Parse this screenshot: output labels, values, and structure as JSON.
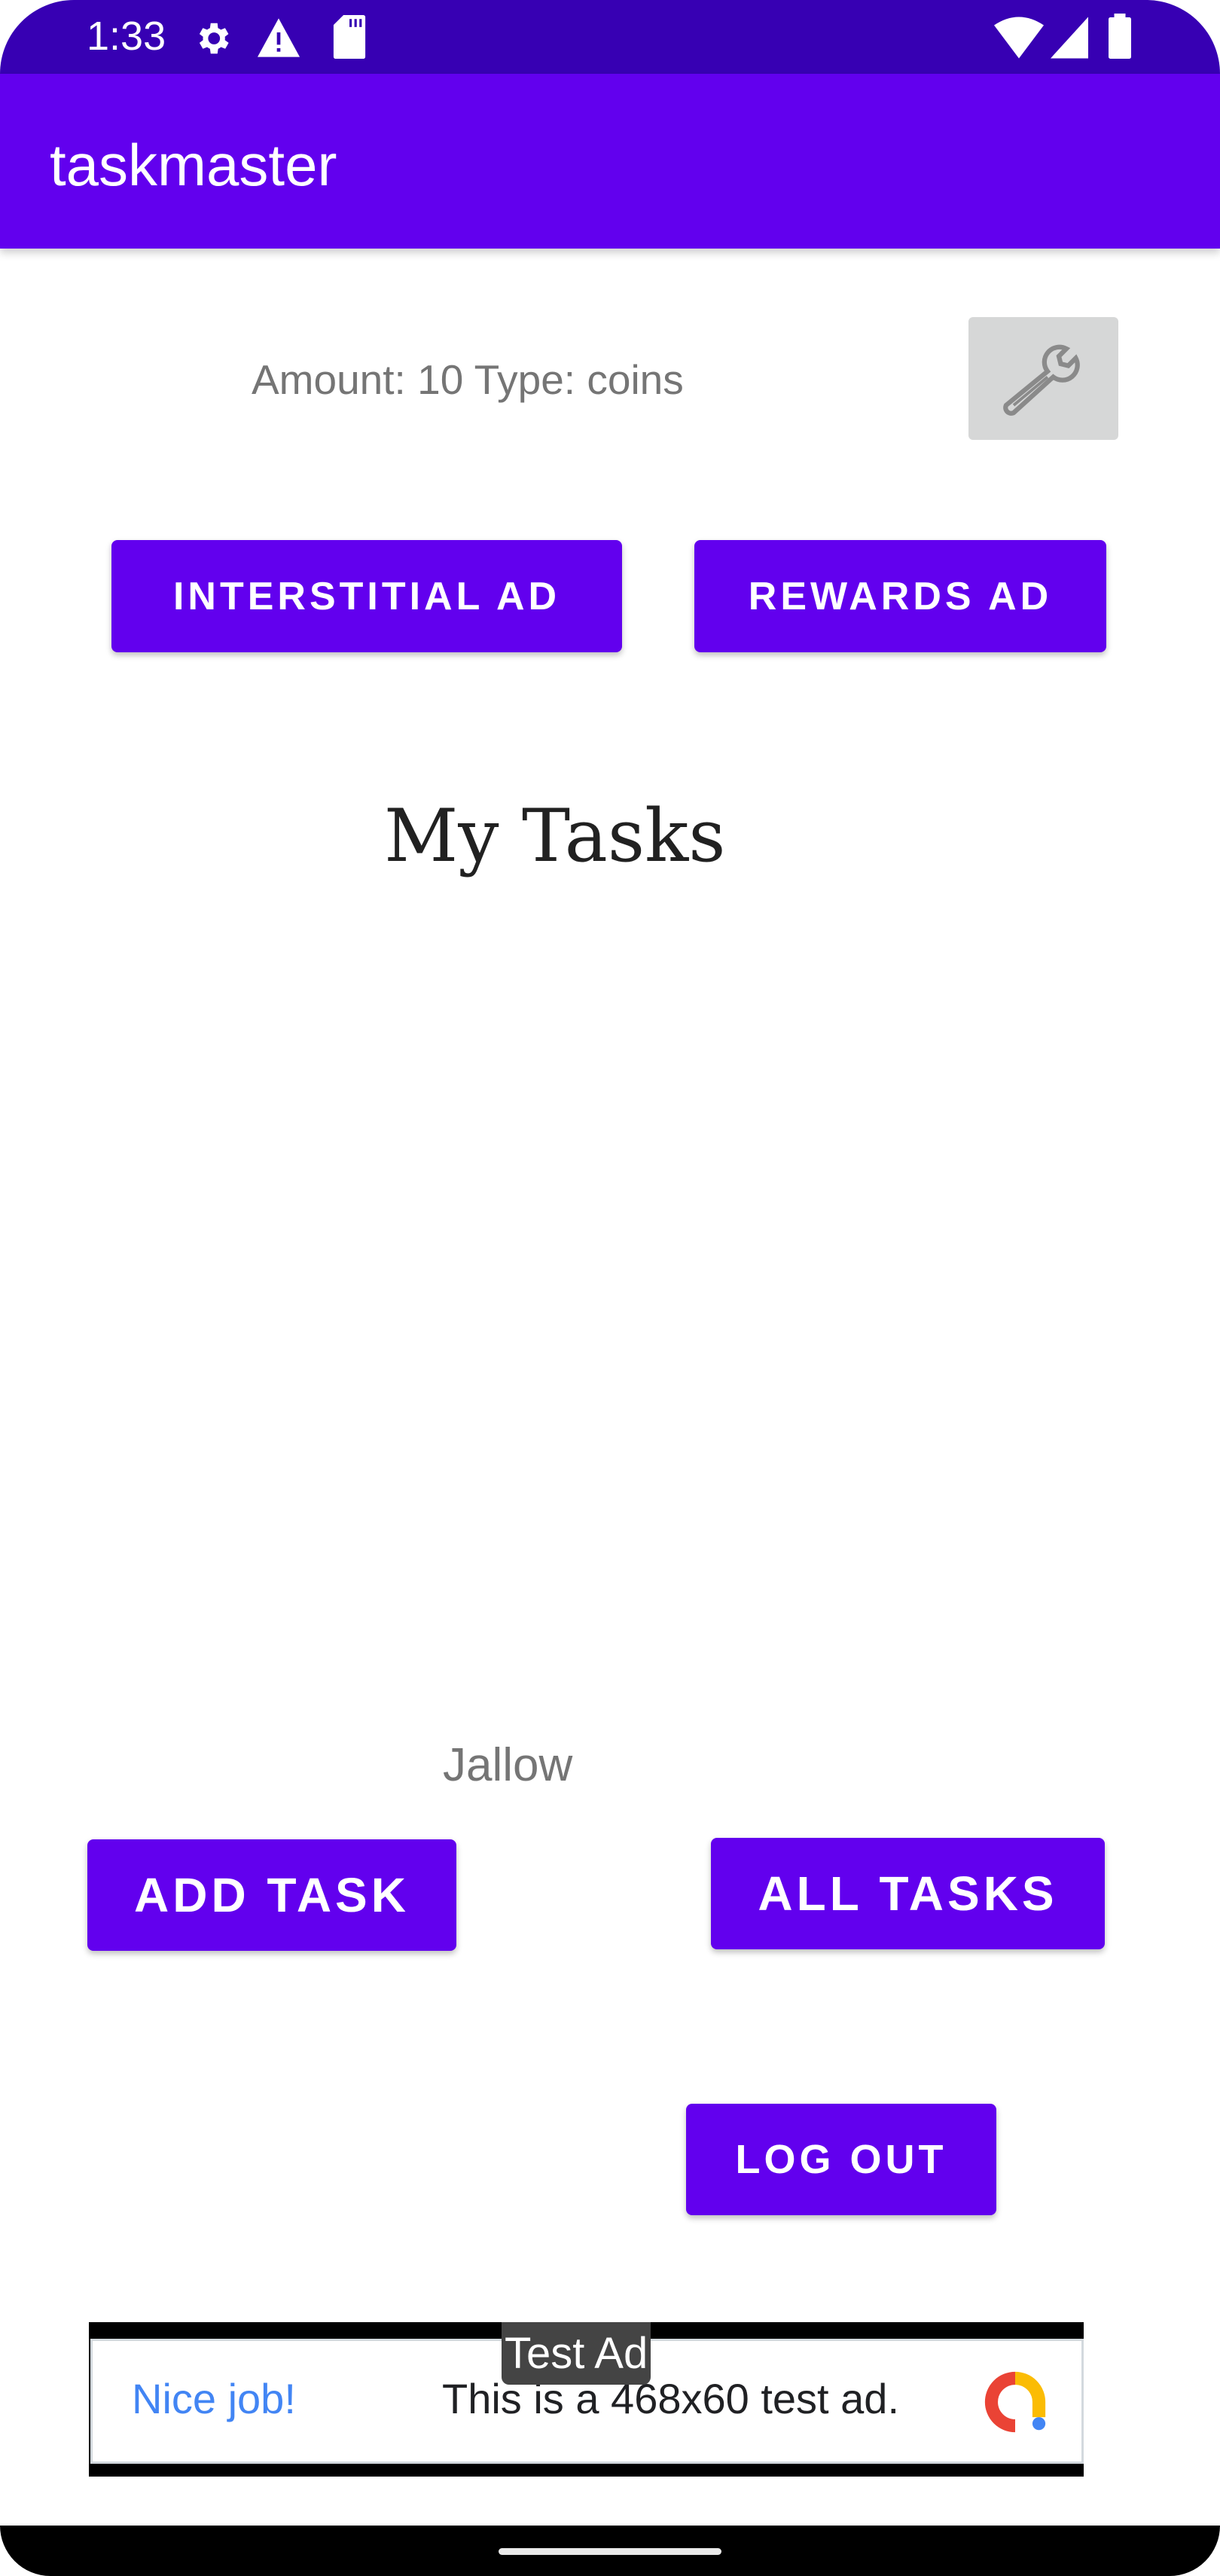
{
  "status_bar": {
    "time": "1:33",
    "icons": [
      "gear-icon",
      "warning-icon",
      "sd-card-icon",
      "wifi-icon",
      "signal-icon",
      "battery-icon"
    ]
  },
  "app_bar": {
    "title": "taskmaster"
  },
  "reward": {
    "text": "Amount: 10 Type: coins"
  },
  "buttons": {
    "interstitial": "Interstitial Ad",
    "rewards": "Rewards Ad",
    "add_task": "Add Task",
    "all_tasks": "All Tasks",
    "log_out": "Log Out"
  },
  "heading": "My Tasks",
  "username": "Jallow",
  "ad": {
    "badge": "Test Ad",
    "headline": "Nice job!",
    "body": "This is a 468x60 test ad."
  },
  "colors": {
    "primary": "#6200ee",
    "primary_dark": "#3700b3",
    "ad_blue": "#4285f4"
  }
}
